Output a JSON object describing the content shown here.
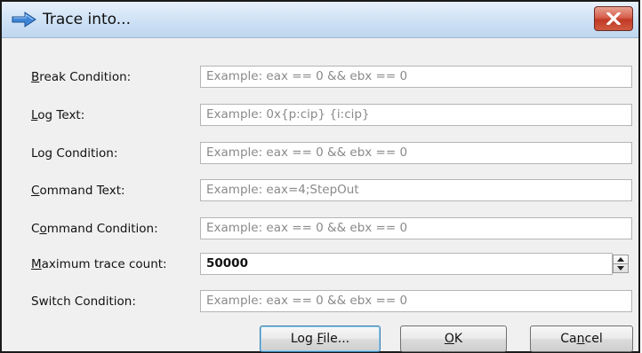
{
  "window": {
    "title": "Trace into...",
    "title_icon": "blue-arrow-icon",
    "close_icon": "close-icon"
  },
  "form": {
    "rows": [
      {
        "label_pre": "",
        "label_key": "B",
        "label_post": "reak Condition:",
        "placeholder": "Example: eax == 0 && ebx == 0",
        "value": ""
      },
      {
        "label_pre": "",
        "label_key": "L",
        "label_post": "og Text:",
        "placeholder": "Example: 0x{p:cip} {i:cip}",
        "value": ""
      },
      {
        "label_pre": "Log Co",
        "label_key": "",
        "label_post": "ndition:",
        "placeholder": "Example: eax == 0 && ebx == 0",
        "value": ""
      },
      {
        "label_pre": "",
        "label_key": "C",
        "label_post": "ommand Text:",
        "placeholder": "Example: eax=4;StepOut",
        "value": ""
      },
      {
        "label_pre": "C",
        "label_key": "o",
        "label_post": "mmand Condition:",
        "placeholder": "Example: eax == 0 && ebx == 0",
        "value": ""
      },
      {
        "label_pre": "",
        "label_key": "M",
        "label_post": "aximum trace count:",
        "placeholder": "",
        "value": "50000"
      },
      {
        "label_pre": "Switch Condition:",
        "label_key": "",
        "label_post": "",
        "placeholder": "Example: eax == 0 && ebx == 0",
        "value": ""
      }
    ]
  },
  "buttons": {
    "log_file_pre": "Log ",
    "log_file_key": "F",
    "log_file_post": "ile...",
    "ok_key": "O",
    "ok_post": "K",
    "cancel_pre": "Ca",
    "cancel_key": "n",
    "cancel_post": "cel"
  }
}
